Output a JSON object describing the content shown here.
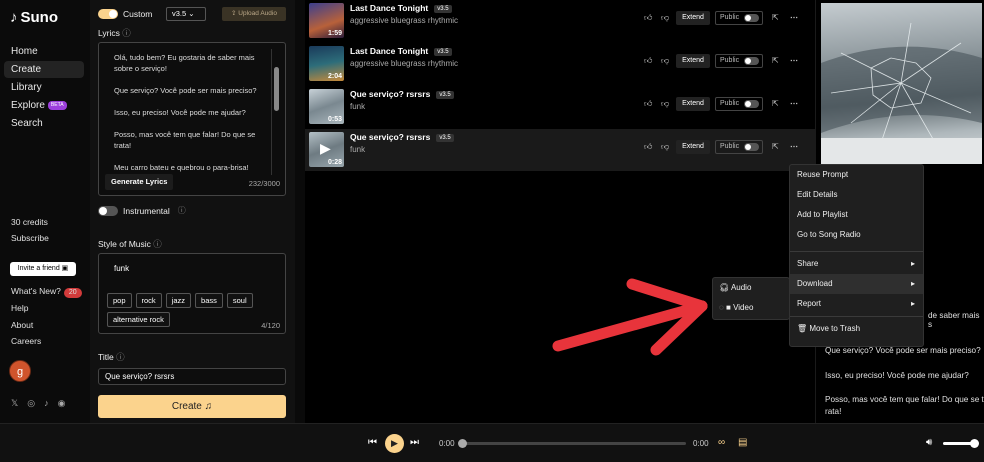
{
  "app": {
    "name": "Suno"
  },
  "nav": [
    {
      "label": "Home"
    },
    {
      "label": "Create"
    },
    {
      "label": "Library"
    },
    {
      "label": "Explore",
      "badge": "BETA"
    },
    {
      "label": "Search"
    }
  ],
  "account": {
    "credits": "30 credits",
    "subscribe": "Subscribe",
    "invite": "Invite a friend",
    "whats_new": "What's New?",
    "whats_new_count": "20",
    "help": "Help",
    "about": "About",
    "careers": "Careers",
    "avatar_letter": "g"
  },
  "create": {
    "custom_label": "Custom",
    "version": "v3.5",
    "upload": "Upload Audio",
    "lyrics_label": "Lyrics",
    "lyrics_lines": [
      "Olá, tudo bem? Eu gostaria de saber mais",
      "sobre o serviço!",
      "",
      "Que serviço? Você pode ser mais preciso?",
      "",
      "Isso, eu preciso! Você pode me ajudar?",
      "",
      "Posso, mas você tem que falar! Do que se",
      "trata!",
      "",
      "Meu carro bateu e quebrou o para-brisa!"
    ],
    "generate_lyrics": "Generate Lyrics",
    "lyrics_count": "232/3000",
    "instrumental_label": "Instrumental",
    "style_label": "Style of Music",
    "style_value": "funk",
    "style_tags": [
      "pop",
      "rock",
      "jazz",
      "bass",
      "soul",
      "alternative rock"
    ],
    "style_count": "4/120",
    "title_label": "Title",
    "title_value": "Que serviço? rsrsrs",
    "create_button": "Create"
  },
  "songs": [
    {
      "title": "Last Dance Tonight",
      "version": "v3.5",
      "style": "aggressive bluegrass rhythmic",
      "duration": "1:59",
      "extend": "Extend",
      "public": "Public"
    },
    {
      "title": "Last Dance Tonight",
      "version": "v3.5",
      "style": "aggressive bluegrass rhythmic",
      "duration": "2:04",
      "extend": "Extend",
      "public": "Public"
    },
    {
      "title": "Que serviço? rsrsrs",
      "version": "v3.5",
      "style": "funk",
      "duration": "0:53",
      "extend": "Extend",
      "public": "Public"
    },
    {
      "title": "Que serviço? rsrsrs",
      "version": "v3.5",
      "style": "funk",
      "duration": "0:28",
      "extend": "Extend",
      "public": "Public"
    }
  ],
  "context_menu": {
    "items": [
      "Reuse Prompt",
      "Edit Details",
      "Add to Playlist",
      "Go to Song Radio"
    ],
    "share": "Share",
    "download": "Download",
    "report": "Report",
    "trash": "Move to Trash"
  },
  "download_menu": {
    "audio": "Audio",
    "video": "Video"
  },
  "right_panel": {
    "lines": [
      "de saber mais s",
      "Que serviço? Você pode ser mais preciso?",
      "Isso, eu preciso! Você pode me ajudar?",
      "Posso, mas você tem que falar! Do que se t",
      "rata!"
    ]
  },
  "player": {
    "time_current": "0:00",
    "time_total": "0:00"
  },
  "colors": {
    "accent": "#fbd38d",
    "arrow": "#e8343b",
    "beta": "#9c3fdc"
  }
}
